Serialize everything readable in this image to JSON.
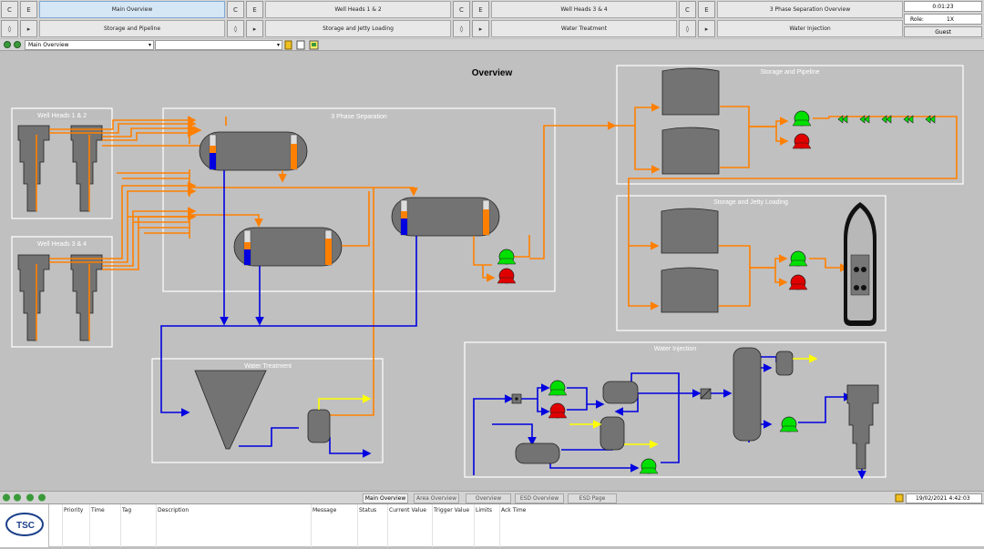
{
  "nav": {
    "row1": [
      "Main Overview",
      "Well Heads 1 & 2",
      "Well Heads 3 & 4",
      "3 Phase Separation Overview"
    ],
    "row2": [
      "Storage and Pipeline",
      "Storage and Jetty Loading",
      "Water Treatment",
      "Water Injection"
    ],
    "row1_btn_a": "C",
    "row1_btn_b": "E",
    "row2_btn_a": "◊",
    "row2_btn_b": "▸"
  },
  "status": {
    "time": "0:01:23",
    "role_label": "Role:",
    "role_value": "1X",
    "user": "Guest"
  },
  "toolbar": {
    "view_selected": "Main Overview"
  },
  "diagram": {
    "title": "Overview",
    "units": {
      "wellheads_12": "Well Heads 1 & 2",
      "wellheads_34": "Well Heads 3 & 4",
      "separation": "3 Phase Separation",
      "storage_pipeline": "Storage and Pipeline",
      "storage_jetty": "Storage and Jetty Loading",
      "water_treatment": "Water Treatment",
      "water_injection": "Water Injection"
    }
  },
  "bottom_tabs": [
    "Main Overview",
    "Area Overview",
    "Overview",
    "ESD Overview",
    "ESD Page"
  ],
  "datetime": "19/02/2021  4:42:03",
  "alarm_columns": [
    "Priority",
    "Time",
    "Tag",
    "Description",
    "Message",
    "Status",
    "Current Value",
    "Trigger Value",
    "Limits",
    "Ack Time"
  ],
  "logo_text": "TSC",
  "colors": {
    "oil": "#ff8000",
    "water": "#0000e0",
    "gas": "#ffff00",
    "pump_run": "#00d000",
    "pump_stop": "#e00000",
    "vessel": "#737373"
  }
}
